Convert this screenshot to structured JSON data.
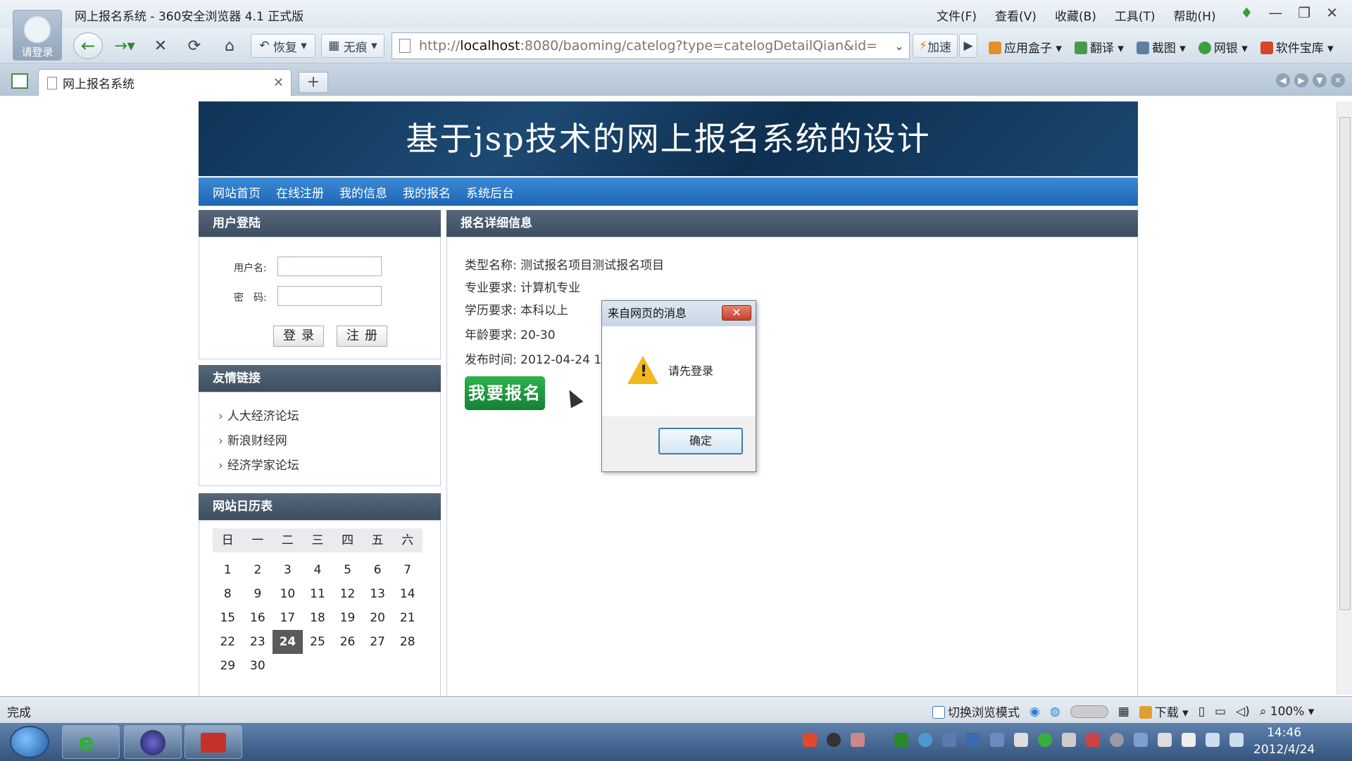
{
  "window": {
    "title": "网上报名系统 - 360安全浏览器 4.1 正式版",
    "avatar_label": "请登录"
  },
  "menu": [
    "文件(F)",
    "查看(V)",
    "收藏(B)",
    "工具(T)",
    "帮助(H)"
  ],
  "toolbar": {
    "restore_label": "恢复",
    "trace_label": "无痕",
    "url_prefix": "http://",
    "url_host": "localhost",
    "url_rest": ":8080/baoming/catelog?type=catelogDetailQian&id=",
    "speed_label": "加速",
    "right_tools": [
      "应用盒子",
      "翻译",
      "截图",
      "网银",
      "软件宝库"
    ]
  },
  "tab": {
    "title": "网上报名系统"
  },
  "site": {
    "banner": "基于jsp技术的网上报名系统的设计",
    "nav": [
      "网站首页",
      "在线注册",
      "我的信息",
      "我的报名",
      "系统后台"
    ],
    "login": {
      "header": "用户登陆",
      "username_label": "用户名:",
      "password_label": "密　码:",
      "login_btn": "登录",
      "register_btn": "注册"
    },
    "links": {
      "header": "友情链接",
      "items": [
        "人大经济论坛",
        "新浪财经网",
        "经济学家论坛"
      ]
    },
    "calendar": {
      "header": "网站日历表",
      "weekdays": [
        "日",
        "一",
        "二",
        "三",
        "四",
        "五",
        "六"
      ],
      "weeks": [
        [
          "1",
          "2",
          "3",
          "4",
          "5",
          "6",
          "7"
        ],
        [
          "8",
          "9",
          "10",
          "11",
          "12",
          "13",
          "14"
        ],
        [
          "15",
          "16",
          "17",
          "18",
          "19",
          "20",
          "21"
        ],
        [
          "22",
          "23",
          "24",
          "25",
          "26",
          "27",
          "28"
        ],
        [
          "29",
          "30",
          "",
          "",
          "",
          "",
          ""
        ]
      ],
      "today": "24"
    },
    "detail": {
      "header": "报名详细信息",
      "type_name": "类型名称: 测试报名项目测试报名项目",
      "major": "专业要求: 计算机专业",
      "education": "学历要求: 本科以上",
      "age": "年龄要求: 20-30",
      "publish_time": "发布时间: 2012-04-24 14",
      "signup_btn": "我要报名"
    }
  },
  "dialog": {
    "title": "来自网页的消息",
    "message": "请先登录",
    "ok": "确定"
  },
  "status": {
    "text": "完成",
    "mode": "切换浏览模式",
    "download": "下载",
    "zoom": "100%"
  },
  "taskbar": {
    "time": "14:46",
    "date": "2012/4/24"
  }
}
